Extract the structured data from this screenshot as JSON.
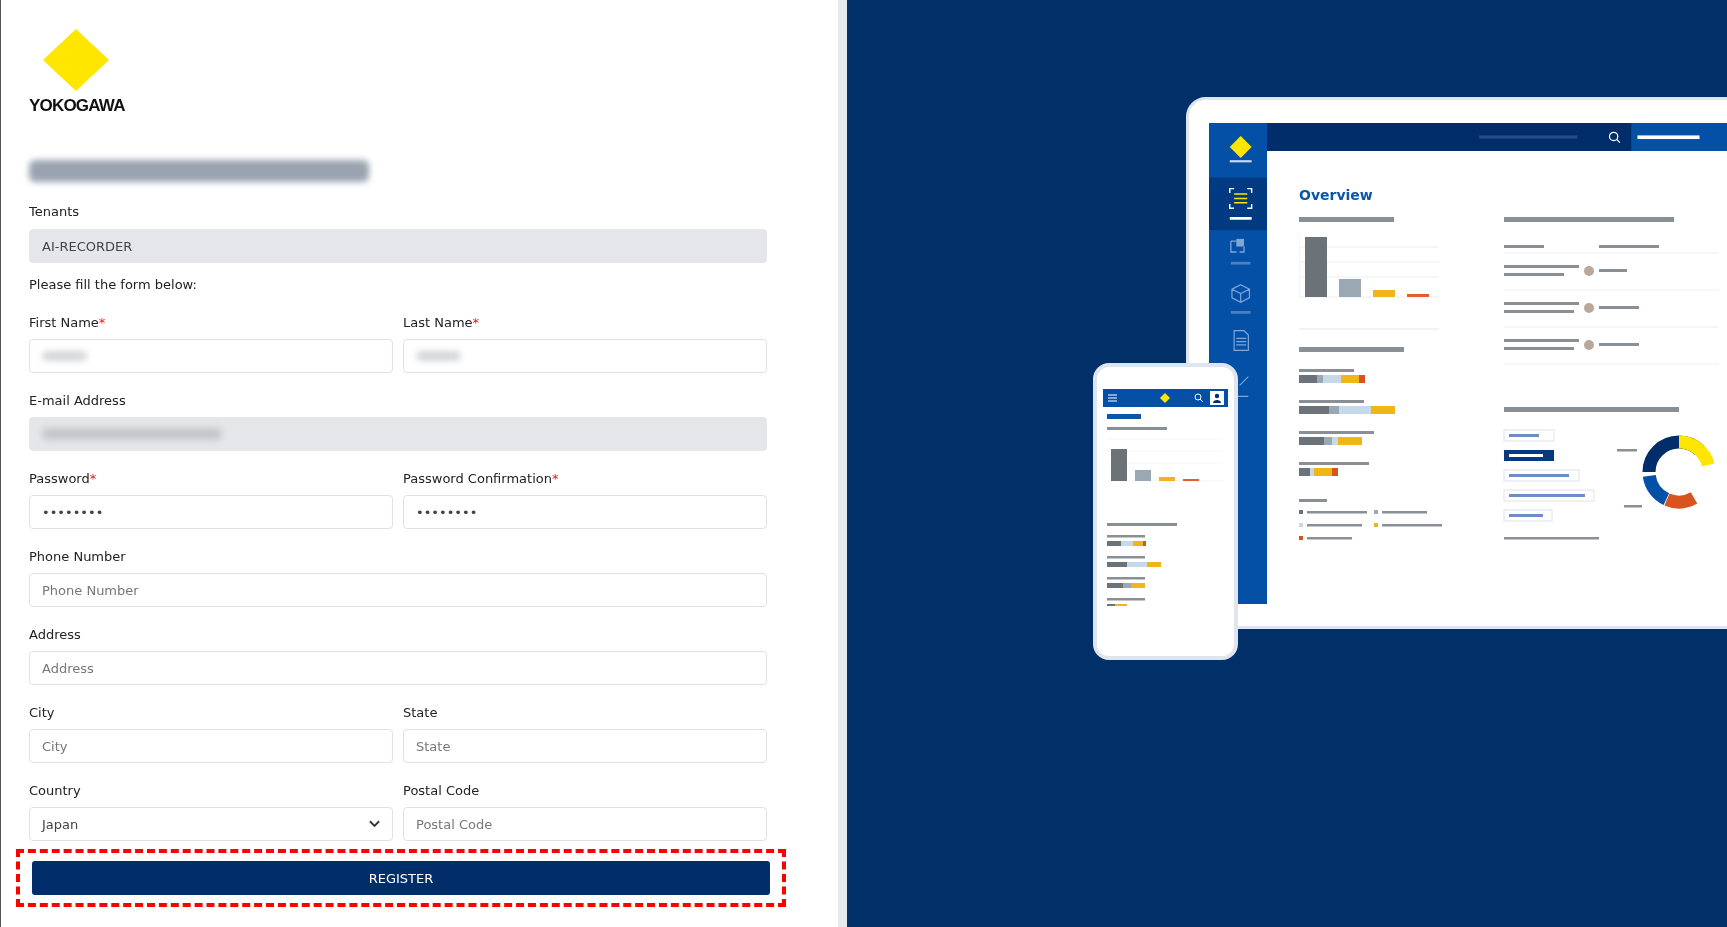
{
  "logo": {
    "text": "YOKOGAWA"
  },
  "heading_redacted": true,
  "tenant": {
    "label": "Tenants",
    "value": "AI-RECORDER"
  },
  "instructions": "Please fill the form below:",
  "required_mark": "*",
  "rows": [
    [
      {
        "label": "First Name",
        "required": true,
        "kind": "redacted"
      },
      {
        "label": "Last Name",
        "required": true,
        "kind": "redacted"
      }
    ],
    [
      {
        "label": "E-mail Address",
        "required": false,
        "kind": "redacted_disabled"
      }
    ],
    [
      {
        "label": "Password",
        "required": true,
        "kind": "text",
        "value": "••••••••"
      },
      {
        "label": "Password Confirmation",
        "required": true,
        "kind": "text",
        "value": "••••••••"
      }
    ],
    [
      {
        "label": "Phone Number",
        "required": false,
        "kind": "text",
        "placeholder": "Phone Number"
      }
    ],
    [
      {
        "label": "Address",
        "required": false,
        "kind": "text",
        "placeholder": "Address"
      }
    ],
    [
      {
        "label": "City",
        "required": false,
        "kind": "text",
        "placeholder": "City"
      },
      {
        "label": "State",
        "required": false,
        "kind": "text",
        "placeholder": "State"
      }
    ],
    [
      {
        "label": "Country",
        "required": false,
        "kind": "select",
        "value": "Japan"
      },
      {
        "label": "Postal Code",
        "required": false,
        "kind": "text",
        "placeholder": "Postal Code"
      }
    ]
  ],
  "register_button": {
    "label": "REGISTER",
    "highlighted": true
  },
  "showcase": {
    "title": "Overview"
  }
}
